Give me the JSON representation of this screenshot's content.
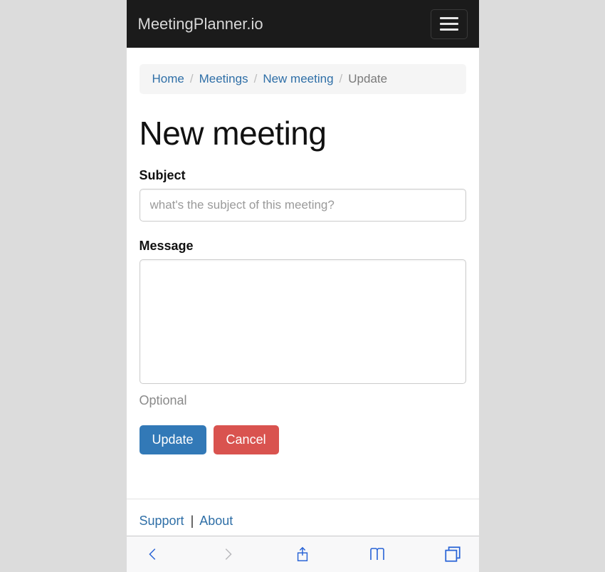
{
  "navbar": {
    "brand": "MeetingPlanner.io"
  },
  "breadcrumb": {
    "items": [
      {
        "label": "Home",
        "active": false
      },
      {
        "label": "Meetings",
        "active": false
      },
      {
        "label": "New meeting",
        "active": false
      },
      {
        "label": "Update",
        "active": true
      }
    ]
  },
  "page": {
    "title": "New meeting"
  },
  "form": {
    "subject": {
      "label": "Subject",
      "placeholder": "what's the subject of this meeting?",
      "value": ""
    },
    "message": {
      "label": "Message",
      "value": "",
      "hint": "Optional"
    },
    "buttons": {
      "update": "Update",
      "cancel": "Cancel"
    }
  },
  "footer": {
    "support": "Support",
    "about": "About"
  }
}
